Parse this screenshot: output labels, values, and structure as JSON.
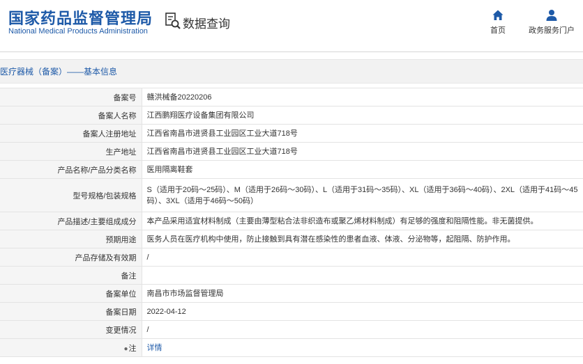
{
  "header": {
    "logo_cn": "国家药品监督管理局",
    "logo_en": "National Medical Products Administration",
    "query_label": "数据查询",
    "nav_home": "首页",
    "nav_personal": "政务服务门户"
  },
  "breadcrumb": "医疗器械（备案）——基本信息",
  "rows": [
    {
      "label": "备案号",
      "value": "赣洪械备20220206"
    },
    {
      "label": "备案人名称",
      "value": "江西鹏翔医疗设备集团有限公司"
    },
    {
      "label": "备案人注册地址",
      "value": "江西省南昌市进贤县工业园区工业大道718号"
    },
    {
      "label": "生产地址",
      "value": "江西省南昌市进贤县工业园区工业大道718号"
    },
    {
      "label": "产品名称/产品分类名称",
      "value": "医用隔离鞋套"
    },
    {
      "label": "型号规格/包装规格",
      "value": "S（适用于20码～25码）、M（适用于26码～30码）、L（适用于31码～35码）、XL（适用于36码～40码）、2XL（适用于41码～45码）、3XL（适用于46码～50码）"
    },
    {
      "label": "产品描述/主要组成成分",
      "value": "本产品采用适宜材料制成（主要由薄型粘合法非织造布或聚乙烯材料制成）有足够的强度和阻隔性能。非无菌提供。"
    },
    {
      "label": "预期用途",
      "value": "医务人员在医疗机构中使用，防止接触到具有潜在感染性的患者血液、体液、分泌物等，起阻隔、防护作用。"
    },
    {
      "label": "产品存储及有效期",
      "value": "/"
    },
    {
      "label": "备注",
      "value": ""
    },
    {
      "label": "备案单位",
      "value": "南昌市市场监督管理局"
    },
    {
      "label": "备案日期",
      "value": "2022-04-12"
    },
    {
      "label": "变更情况",
      "value": "/"
    },
    {
      "label": "注",
      "value": "详情"
    }
  ]
}
